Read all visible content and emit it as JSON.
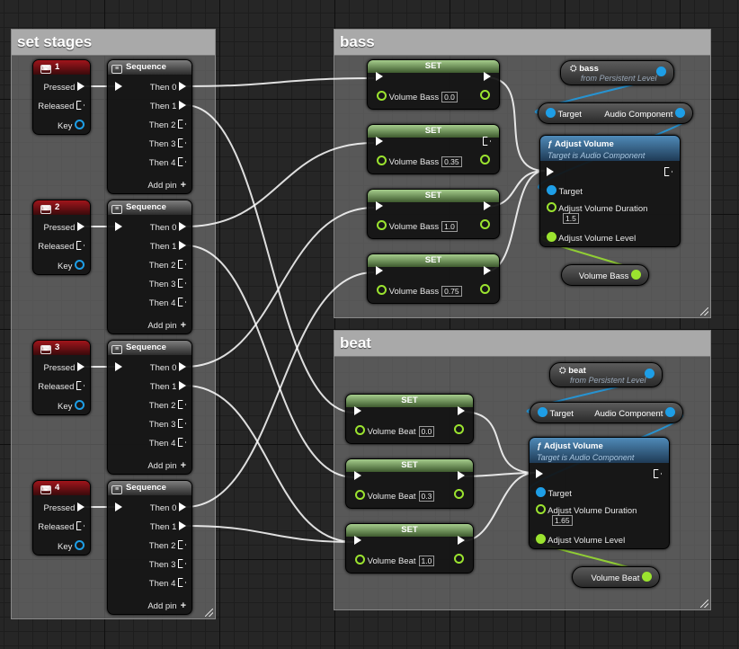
{
  "comments": {
    "set_stages": "set stages",
    "bass": "bass",
    "beat": "beat"
  },
  "input_event": {
    "pressed": "Pressed",
    "released": "Released",
    "key": "Key",
    "labels": [
      "1",
      "2",
      "3",
      "4"
    ],
    "icon": "keyboard-icon"
  },
  "sequence": {
    "title": "Sequence",
    "outputs": [
      "Then 0",
      "Then 1",
      "Then 2",
      "Then 3",
      "Then 4"
    ],
    "add_pin": "Add pin"
  },
  "set_node": {
    "title": "SET"
  },
  "bass_sets": {
    "label": "Volume Bass",
    "values": [
      "0.0",
      "0.35",
      "1.0",
      "0.75"
    ]
  },
  "beat_sets": {
    "label": "Volume Beat",
    "values": [
      "0.0",
      "0.3",
      "1.0"
    ]
  },
  "bass_group": {
    "var_name": "bass",
    "var_sub": "from Persistent Level",
    "get_target": "Target",
    "get_output": "Audio Component",
    "fn_title": "Adjust Volume",
    "fn_sub": "Target is Audio Component",
    "fn_target": "Target",
    "fn_duration": "Adjust Volume Duration",
    "fn_duration_value": "1.5",
    "fn_level": "Adjust Volume Level",
    "volume_var": "Volume Bass"
  },
  "beat_group": {
    "var_name": "beat",
    "var_sub": "from Persistent Level",
    "get_target": "Target",
    "get_output": "Audio Component",
    "fn_title": "Adjust Volume",
    "fn_sub": "Target is Audio Component",
    "fn_target": "Target",
    "fn_duration": "Adjust Volume Duration",
    "fn_duration_value": "1.65",
    "fn_level": "Adjust Volume Level",
    "volume_var": "Volume Beat"
  },
  "colors": {
    "exec_wire": "#ffffff",
    "object_pin": "#1e9ee6",
    "float_pin": "#9be32f",
    "event_header": "#a0151b",
    "set_header": "#a5cd8c",
    "function_header": "#4f8ab8"
  }
}
